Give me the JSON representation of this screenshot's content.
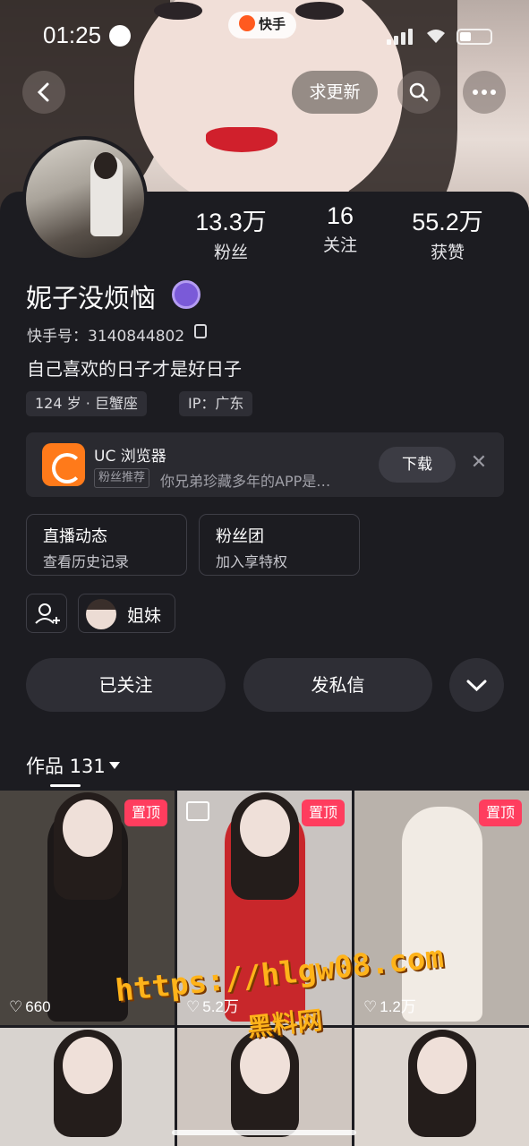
{
  "status_bar": {
    "time": "01:25"
  },
  "app_badge": "快手",
  "nav": {
    "request_update": "求更新"
  },
  "profile": {
    "stats": [
      {
        "value": "13.3万",
        "label": "粉丝"
      },
      {
        "value": "16",
        "label": "关注"
      },
      {
        "value": "55.2万",
        "label": "获赞"
      }
    ],
    "name": "妮子没烦恼",
    "kuaishou_id": "快手号：3140844802",
    "bio": "自己喜欢的日子才是好日子",
    "tags": [
      "124 岁 · 巨蟹座",
      "IP：广东"
    ]
  },
  "ad": {
    "title": "UC 浏览器",
    "label": "粉丝推荐",
    "desc": "你兄弟珍藏多年的APP是…",
    "download": "下载",
    "close": "✕"
  },
  "cards": [
    {
      "title": "直播动态",
      "sub": "查看历史记录"
    },
    {
      "title": "粉丝团",
      "sub": "加入享特权"
    }
  ],
  "relation": "姐妹",
  "actions": {
    "followed": "已关注",
    "message": "发私信"
  },
  "works": {
    "label": "作品 131"
  },
  "grid": [
    {
      "pin": "置顶",
      "likes": "660",
      "bg": "#4a4540"
    },
    {
      "pin": "置顶",
      "likes": "5.2万",
      "bg": "#c9c4c1"
    },
    {
      "pin": "置顶",
      "likes": "1.2万",
      "bg": "#b9b2ab"
    },
    {
      "bg": "#d8d3cf"
    },
    {
      "bg": "#cfc6c0"
    },
    {
      "bg": "#ddd6d0"
    }
  ],
  "watermark": {
    "url": "https://hlgw08.com",
    "name": "黑料网"
  },
  "colors": {
    "background": "#1c1c21",
    "pin": "#ff3d5e",
    "card_bg": "#2e2e35"
  }
}
